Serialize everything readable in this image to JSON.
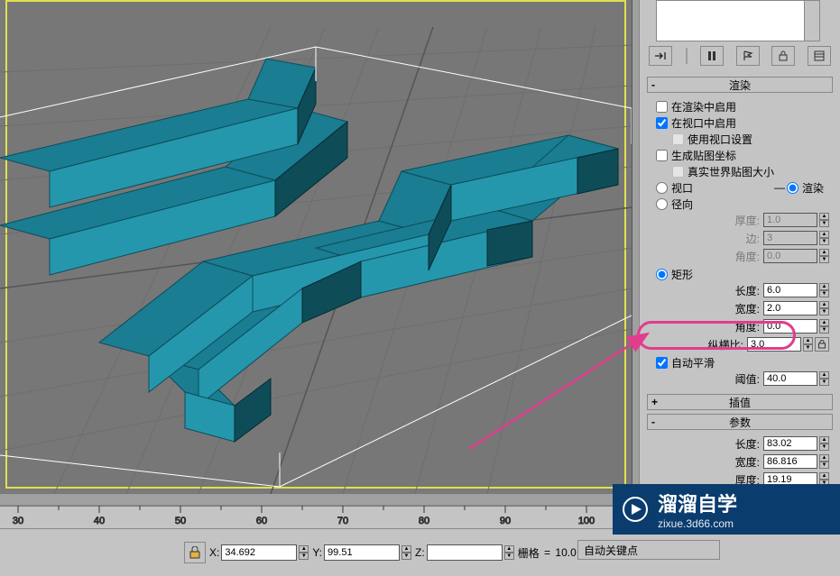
{
  "viewport": {
    "grid_major": 10
  },
  "icon_row": [
    "pin-left",
    "separator",
    "pause",
    "flag",
    "lock",
    "sheet"
  ],
  "rollouts": {
    "render": {
      "header": "渲染",
      "enable_in_render": {
        "label": "在渲染中启用",
        "checked": false
      },
      "enable_in_viewport": {
        "label": "在视口中启用",
        "checked": true
      },
      "use_viewport_settings": {
        "label": "使用视口设置",
        "checked": false,
        "disabled": true
      },
      "gen_map_coords": {
        "label": "生成贴图坐标",
        "checked": false
      },
      "real_world_map": {
        "label": "真实世界贴图大小",
        "checked": false,
        "disabled": true
      },
      "mode": {
        "viewport_label": "视口",
        "render_label": "渲染",
        "selected": "render"
      },
      "radial": {
        "label": "径向",
        "selected": false,
        "thickness": {
          "label": "厚度:",
          "value": "1.0"
        },
        "sides": {
          "label": "边:",
          "value": "3"
        },
        "angle": {
          "label": "角度:",
          "value": "0.0"
        }
      },
      "rectangular": {
        "label": "矩形",
        "selected": true,
        "length": {
          "label": "长度:",
          "value": "6.0"
        },
        "width": {
          "label": "宽度:",
          "value": "2.0"
        },
        "angle": {
          "label": "角度:",
          "value": "0.0"
        },
        "aspect": {
          "label": "纵横比:",
          "value": "3.0"
        }
      },
      "auto_smooth": {
        "label": "自动平滑",
        "checked": true
      },
      "threshold": {
        "label": "阈值:",
        "value": "40.0"
      }
    },
    "interpolation": {
      "header": "插值"
    },
    "parameters": {
      "header": "参数",
      "length": {
        "label": "长度:",
        "value": "83.02"
      },
      "width": {
        "label": "宽度:",
        "value": "86.816"
      },
      "thickness": {
        "label": "厚度:",
        "value": "19.19"
      }
    }
  },
  "ruler": {
    "ticks": [
      "30",
      "40",
      "50",
      "60",
      "70",
      "80",
      "90",
      "100"
    ]
  },
  "status": {
    "x": {
      "label": "X:",
      "value": "34.692"
    },
    "y": {
      "label": "Y:",
      "value": "99.51"
    },
    "z": {
      "label": "Z:",
      "value": ""
    },
    "grid": {
      "label": "栅格",
      "value": "10.0"
    },
    "auto_key": "自动关键点"
  },
  "watermark": {
    "brand": "溜溜自学",
    "url": "zixue.3d66.com"
  }
}
